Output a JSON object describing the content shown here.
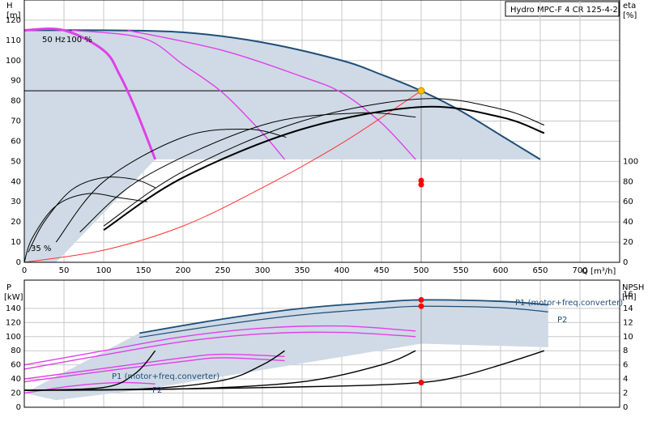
{
  "title": "Hydro MPC-F 4 CR 125-4-2",
  "top_labels": {
    "speed_full": "50 Hz",
    "speed_pct": "100 %",
    "speed_min": "35 %"
  },
  "bottom_labels": {
    "p1_right": "P1 (motor+freq.converter)",
    "p2_right": "P2",
    "p1_left": "P1 (motor+freq.converter)",
    "p2_left": "P2"
  },
  "colors": {
    "band": "#cfdae6",
    "max_curve": "#1f4e79",
    "partial_curve": "#e040e8",
    "system_curve": "#ff3030",
    "duty_point": "#ff0000",
    "duty_point_top": "#ffc000"
  },
  "chart_data": [
    {
      "type": "line",
      "xlabel": "Q [m³/h]",
      "ylabel": "H [m]",
      "y2label": "eta [%]",
      "xlim": [
        0,
        750
      ],
      "ylim": [
        0,
        130
      ],
      "y2lim": [
        0,
        130
      ],
      "xticks": [
        0,
        50,
        100,
        150,
        200,
        250,
        300,
        350,
        400,
        450,
        500,
        550,
        600,
        650,
        700
      ],
      "yticks": [
        0,
        10,
        20,
        30,
        40,
        50,
        60,
        70,
        80,
        90,
        100,
        110,
        120
      ],
      "y2ticks": [
        0,
        20,
        40,
        60,
        80,
        100
      ],
      "duty_point": {
        "q": 500,
        "h": 85,
        "eta1": 81,
        "eta2": 77
      },
      "duty_line_h": 85,
      "series": [
        {
          "role": "max",
          "x": [
            0,
            100,
            200,
            300,
            400,
            450,
            500,
            550,
            600,
            650
          ],
          "y": [
            115,
            115,
            114,
            109,
            100,
            93,
            85,
            75,
            63,
            51
          ]
        },
        {
          "role": "partial",
          "x": [
            0,
            50,
            100,
            120,
            140,
            165
          ],
          "y": [
            115,
            115,
            105,
            93,
            76,
            51
          ]
        },
        {
          "role": "partial",
          "x": [
            60,
            150,
            200,
            250,
            300,
            328
          ],
          "y": [
            115,
            111,
            98,
            84,
            64,
            51
          ]
        },
        {
          "role": "partial",
          "x": [
            130,
            250,
            350,
            400,
            450,
            493
          ],
          "y": [
            115,
            105,
            92,
            84,
            69,
            51
          ]
        },
        {
          "role": "system",
          "x": [
            0,
            100,
            200,
            300,
            400,
            500
          ],
          "y": [
            0,
            6,
            18,
            37,
            59,
            85
          ]
        },
        {
          "role": "eta",
          "x": [
            0,
            10,
            40,
            80,
            120,
            155
          ],
          "y": [
            0,
            12,
            28,
            34,
            32,
            30
          ]
        },
        {
          "role": "eta",
          "x": [
            5,
            25,
            60,
            100,
            140,
            165
          ],
          "y": [
            5,
            20,
            36,
            42,
            41,
            37
          ]
        },
        {
          "role": "eta",
          "x": [
            40,
            100,
            200,
            280,
            330
          ],
          "y": [
            10,
            40,
            62,
            66,
            62
          ]
        },
        {
          "role": "eta",
          "x": [
            70,
            150,
            300,
            420,
            493
          ],
          "y": [
            15,
            42,
            68,
            74,
            72
          ]
        },
        {
          "role": "eta",
          "x": [
            100,
            200,
            350,
            500,
            600,
            655
          ],
          "y": [
            18,
            45,
            70,
            81,
            76,
            68
          ]
        },
        {
          "role": "eta",
          "x": [
            100,
            200,
            350,
            500,
            600,
            655
          ],
          "y": [
            16,
            42,
            66,
            77,
            72,
            64
          ]
        }
      ]
    },
    {
      "type": "line",
      "ylabel": "P [kW]",
      "y2label": "NPSH [m]",
      "xlim": [
        0,
        750
      ],
      "ylim": [
        0,
        180
      ],
      "y2lim": [
        0,
        18
      ],
      "yticks": [
        0,
        20,
        40,
        60,
        80,
        100,
        120,
        140
      ],
      "y2ticks": [
        0,
        2,
        4,
        6,
        8,
        10,
        12,
        14,
        16
      ],
      "duty_point": {
        "q": 500,
        "p1": 152,
        "p2": 143,
        "npsh": 3.5
      },
      "series": [
        {
          "role": "p1",
          "x": [
            145,
            250,
            350,
            450,
            500,
            600,
            660
          ],
          "y": [
            105,
            125,
            140,
            149,
            152,
            150,
            145
          ]
        },
        {
          "role": "p2",
          "x": [
            145,
            250,
            350,
            450,
            500,
            600,
            660
          ],
          "y": [
            99,
            117,
            131,
            140,
            143,
            141,
            135
          ]
        },
        {
          "role": "p1-partial",
          "x": [
            0,
            100,
            200,
            300,
            400,
            493
          ],
          "y": [
            60,
            80,
            100,
            112,
            115,
            108
          ]
        },
        {
          "role": "p2-partial",
          "x": [
            0,
            100,
            200,
            300,
            400,
            493
          ],
          "y": [
            54,
            74,
            93,
            104,
            106,
            100
          ]
        },
        {
          "role": "p1-partial",
          "x": [
            0,
            100,
            200,
            250,
            328
          ],
          "y": [
            40,
            55,
            70,
            75,
            72
          ]
        },
        {
          "role": "p2-partial",
          "x": [
            0,
            100,
            200,
            250,
            328
          ],
          "y": [
            36,
            51,
            65,
            70,
            66
          ]
        },
        {
          "role": "p1-partial",
          "x": [
            0,
            60,
            120,
            165
          ],
          "y": [
            20,
            30,
            35,
            33
          ]
        },
        {
          "role": "npsh",
          "x": [
            0,
            200,
            400,
            500,
            550,
            600,
            655
          ],
          "y": [
            2.4,
            2.6,
            3.0,
            3.5,
            4.4,
            6.0,
            8.0
          ]
        },
        {
          "role": "npsh",
          "x": [
            0,
            200,
            350,
            450,
            493
          ],
          "y": [
            2.4,
            2.6,
            3.6,
            6.0,
            8.0
          ]
        },
        {
          "role": "npsh",
          "x": [
            0,
            150,
            250,
            300,
            328
          ],
          "y": [
            2.4,
            2.6,
            3.8,
            6.0,
            8.0
          ]
        },
        {
          "role": "npsh",
          "x": [
            0,
            100,
            140,
            165
          ],
          "y": [
            2.4,
            2.8,
            4.8,
            8.0
          ]
        }
      ]
    }
  ]
}
